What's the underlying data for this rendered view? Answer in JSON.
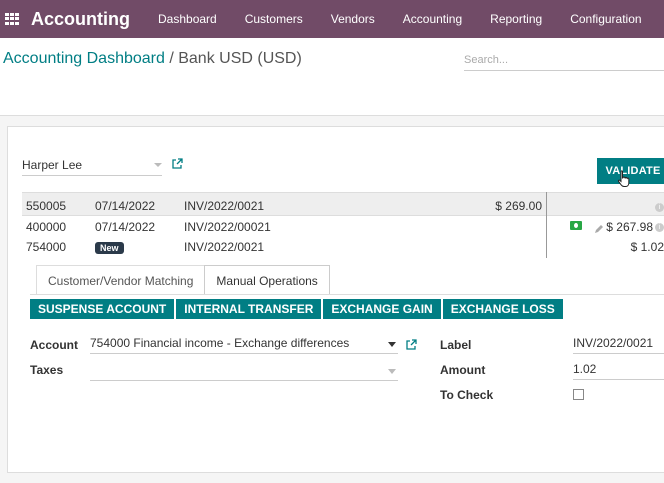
{
  "navbar": {
    "brand": "Accounting",
    "items": [
      "Dashboard",
      "Customers",
      "Vendors",
      "Accounting",
      "Reporting",
      "Configuration"
    ]
  },
  "breadcrumb": {
    "parent": "Accounting Dashboard",
    "separator": " / ",
    "current": "Bank USD (USD)"
  },
  "search": {
    "placeholder": "Search..."
  },
  "partner": {
    "value": "Harper Lee"
  },
  "validate": {
    "label": "VALIDATE"
  },
  "lines": [
    {
      "account": "550005",
      "date": "07/14/2022",
      "ref": "INV/2022/0021",
      "debit": "$ 269.00",
      "credit": ""
    },
    {
      "account": "400000",
      "date": "07/14/2022",
      "ref": "INV/2022/00021",
      "debit": "",
      "credit": "$ 267.98"
    },
    {
      "account": "754000",
      "badge": "New",
      "ref": "INV/2022/0021",
      "debit": "",
      "credit": "$ 1.02"
    }
  ],
  "tabs": [
    "Customer/Vendor Matching",
    "Manual Operations"
  ],
  "operations": [
    "SUSPENSE ACCOUNT",
    "INTERNAL TRANSFER",
    "EXCHANGE GAIN",
    "EXCHANGE LOSS"
  ],
  "form": {
    "account_label": "Account",
    "account_value": "754000 Financial income - Exchange differences",
    "taxes_label": "Taxes",
    "taxes_value": "",
    "label_label": "Label",
    "label_value": "INV/2022/0021",
    "amount_label": "Amount",
    "amount_value": "1.02",
    "to_check_label": "To Check",
    "to_check": false
  },
  "colors": {
    "navbar": "#714b67",
    "accent": "#017e84",
    "money": "#28a745"
  }
}
